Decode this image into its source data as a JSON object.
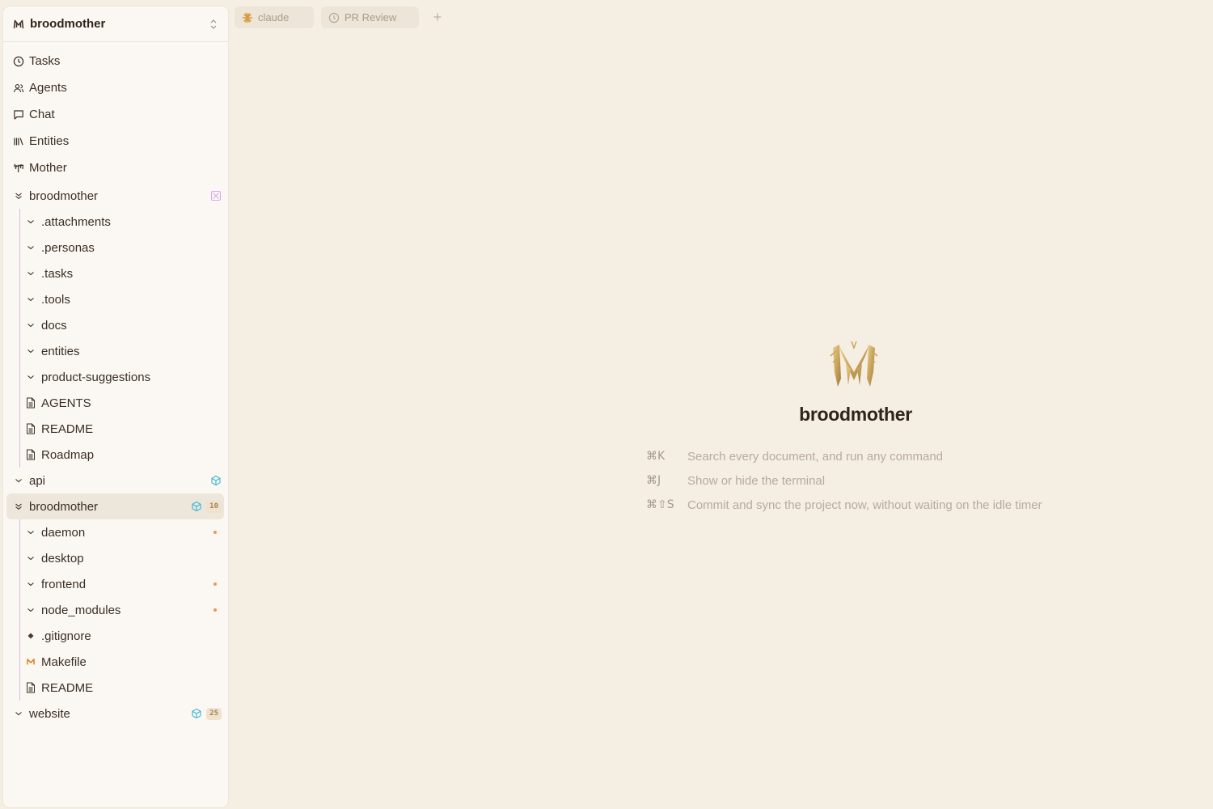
{
  "workspace": {
    "name": "broodmother"
  },
  "nav": [
    {
      "key": "tasks",
      "label": "Tasks",
      "icon": "clock-icon"
    },
    {
      "key": "agents",
      "label": "Agents",
      "icon": "users-icon"
    },
    {
      "key": "chat",
      "label": "Chat",
      "icon": "chat-bubble-icon"
    },
    {
      "key": "entities",
      "label": "Entities",
      "icon": "library-icon"
    },
    {
      "key": "mother",
      "label": "Mother",
      "icon": "mother-icon"
    }
  ],
  "tree": {
    "broodmother_root": {
      "label": "broodmother",
      "icon": "double-chevron-icon",
      "children": [
        {
          "label": ".attachments",
          "type": "folder"
        },
        {
          "label": ".personas",
          "type": "folder"
        },
        {
          "label": ".tasks",
          "type": "folder"
        },
        {
          "label": ".tools",
          "type": "folder"
        },
        {
          "label": "docs",
          "type": "folder"
        },
        {
          "label": "entities",
          "type": "folder"
        },
        {
          "label": "product-suggestions",
          "type": "folder"
        },
        {
          "label": "AGENTS",
          "type": "doc"
        },
        {
          "label": "README",
          "type": "doc"
        },
        {
          "label": "Roadmap",
          "type": "doc"
        }
      ]
    },
    "api": {
      "label": "api"
    },
    "broodmother_repo": {
      "label": "broodmother",
      "badge": "10",
      "children": [
        {
          "label": "daemon",
          "type": "folder",
          "dot": true
        },
        {
          "label": "desktop",
          "type": "folder",
          "dot": false
        },
        {
          "label": "frontend",
          "type": "folder",
          "dot": true
        },
        {
          "label": "node_modules",
          "type": "folder",
          "dot": true
        },
        {
          "label": ".gitignore",
          "type": "gitignore"
        },
        {
          "label": "Makefile",
          "type": "makefile"
        },
        {
          "label": "README",
          "type": "doc"
        }
      ]
    },
    "website": {
      "label": "website",
      "badge": "25"
    }
  },
  "tabs": [
    {
      "label": "claude",
      "icon": "claude-icon"
    },
    {
      "label": "PR Review",
      "icon": "clock-icon"
    }
  ],
  "welcome": {
    "title": "broodmother",
    "shortcuts": [
      {
        "keys": "⌘K",
        "text": "Search every document, and run any command"
      },
      {
        "keys": "⌘J",
        "text": "Show or hide the terminal"
      },
      {
        "keys": "⌘⇧S",
        "text": "Commit and sync the project now, without waiting on the idle timer"
      }
    ]
  },
  "colors": {
    "background": "#f5eee3",
    "sidebar": "#fbf8f3",
    "selected_row": "#ede6da",
    "tree_guide": "#d7b9ea",
    "repo_icon": "#37b5d6",
    "dot": "#e79a55",
    "logo_gold": "#c9a45c"
  }
}
